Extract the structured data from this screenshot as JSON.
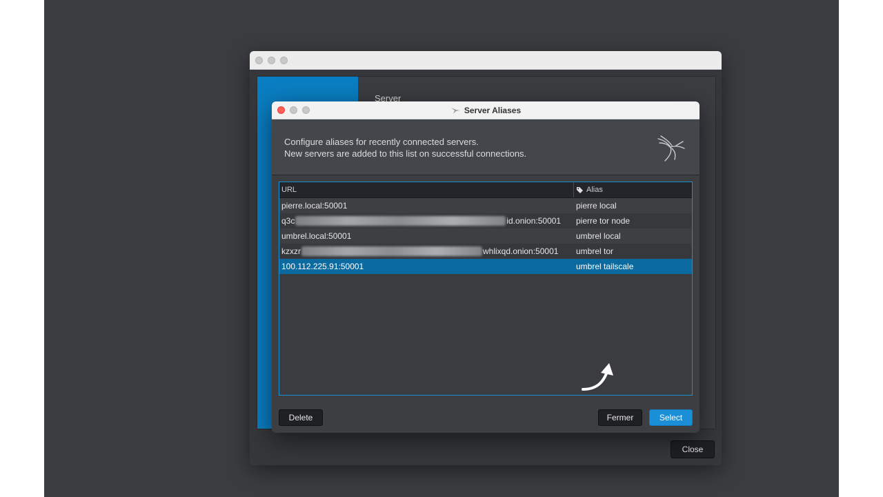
{
  "background_window": {
    "label": "Server",
    "close_label": "Close"
  },
  "dialog": {
    "title": "Server Aliases",
    "description_line1": "Configure aliases for recently connected servers.",
    "description_line2": "New servers are added to this list on successful connections.",
    "columns": {
      "url": "URL",
      "alias": "Alias"
    },
    "rows": [
      {
        "url_prefix": "pierre.local:50001",
        "url_suffix": "",
        "alias": "pierre local"
      },
      {
        "url_prefix": "q3c",
        "url_suffix": "id.onion:50001",
        "alias": "pierre tor node"
      },
      {
        "url_prefix": "umbrel.local:50001",
        "url_suffix": "",
        "alias": "umbrel local"
      },
      {
        "url_prefix": "kzxzr",
        "url_suffix": "whlixqd.onion:50001",
        "alias": "umbrel tor"
      },
      {
        "url_prefix": "100.112.225.91:50001",
        "url_suffix": "",
        "alias": "umbrel tailscale"
      }
    ],
    "buttons": {
      "delete": "Delete",
      "fermer": "Fermer",
      "select": "Select"
    }
  },
  "colors": {
    "accent": "#1a8fd8",
    "selected_row": "#0b6a9f",
    "sidebar": "#0a7ec2"
  }
}
